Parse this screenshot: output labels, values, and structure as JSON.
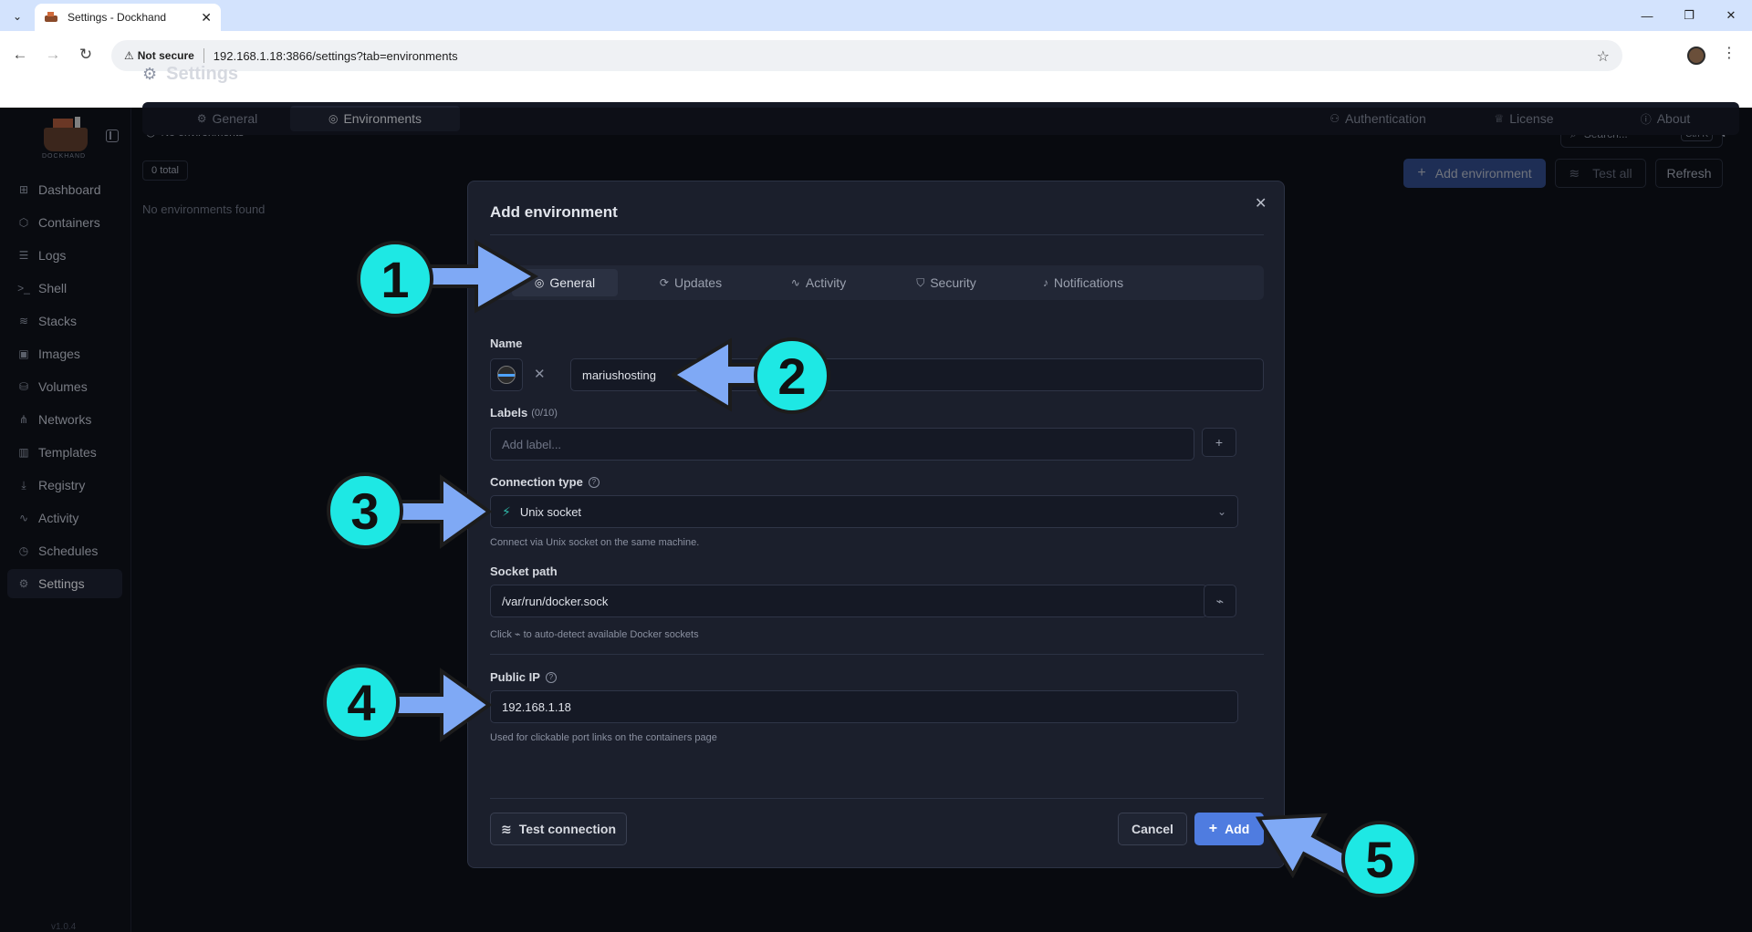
{
  "browser": {
    "tab_title": "Settings - Dockhand",
    "not_secure": "Not secure",
    "url": "192.168.1.18:3866/settings?tab=environments"
  },
  "sidebar": {
    "logo_text": "DOCKHAND",
    "items": [
      {
        "label": "Dashboard",
        "icon": "dashboard-icon",
        "glyph": "⊞"
      },
      {
        "label": "Containers",
        "icon": "box-icon",
        "glyph": "⬡"
      },
      {
        "label": "Logs",
        "icon": "logs-icon",
        "glyph": "☰"
      },
      {
        "label": "Shell",
        "icon": "terminal-icon",
        "glyph": ">_"
      },
      {
        "label": "Stacks",
        "icon": "layers-icon",
        "glyph": "≋"
      },
      {
        "label": "Images",
        "icon": "images-icon",
        "glyph": "▣"
      },
      {
        "label": "Volumes",
        "icon": "database-icon",
        "glyph": "⛁"
      },
      {
        "label": "Networks",
        "icon": "network-icon",
        "glyph": "⋔"
      },
      {
        "label": "Templates",
        "icon": "templates-icon",
        "glyph": "▥"
      },
      {
        "label": "Registry",
        "icon": "download-icon",
        "glyph": "⤓"
      },
      {
        "label": "Activity",
        "icon": "activity-icon",
        "glyph": "∿"
      },
      {
        "label": "Schedules",
        "icon": "clock-icon",
        "glyph": "◷"
      },
      {
        "label": "Settings",
        "icon": "gear-icon",
        "glyph": "⚙"
      }
    ],
    "version": "v1.0.4"
  },
  "topbar": {
    "env_select": "No environments",
    "search_placeholder": "Search...",
    "search_kbd": "Ctrl K"
  },
  "page": {
    "title": "Settings",
    "tabs": [
      {
        "label": "General",
        "glyph": "⚙",
        "active": false
      },
      {
        "label": "Environments",
        "glyph": "◎",
        "active": true
      },
      {
        "label": "Authentication",
        "glyph": "⚇",
        "active": false
      },
      {
        "label": "License",
        "glyph": "♕",
        "active": false
      },
      {
        "label": "About",
        "glyph": "ⓘ",
        "active": false
      }
    ],
    "total_badge": "0 total",
    "empty_text": "No environments found",
    "add_environment": "Add environment",
    "test_all": "Test all",
    "refresh": "Refresh"
  },
  "modal": {
    "title": "Add environment",
    "tabs": [
      {
        "label": "General",
        "glyph": "◎"
      },
      {
        "label": "Updates",
        "glyph": "⟳"
      },
      {
        "label": "Activity",
        "glyph": "∿"
      },
      {
        "label": "Security",
        "glyph": "⛉"
      },
      {
        "label": "Notifications",
        "glyph": "♪"
      }
    ],
    "name_label": "Name",
    "name_value": "mariushosting",
    "labels_label": "Labels",
    "labels_count": "(0/10)",
    "labels_placeholder": "Add label...",
    "connection_label": "Connection type",
    "connection_value": "Unix socket",
    "connection_hint": "Connect via Unix socket on the same machine.",
    "socket_label": "Socket path",
    "socket_value": "/var/run/docker.sock",
    "socket_hint_pre": "Click",
    "socket_hint_post": "to auto-detect available Docker sockets",
    "public_ip_label": "Public IP",
    "public_ip_value": "192.168.1.18",
    "public_ip_hint": "Used for clickable port links on the containers page",
    "test_connection": "Test connection",
    "cancel": "Cancel",
    "add": "Add"
  },
  "callouts": [
    "1",
    "2",
    "3",
    "4",
    "5"
  ],
  "colors": {
    "accent": "#4f7ce0",
    "callout": "#1ee8e4",
    "arrow": "#7fa9f5"
  }
}
